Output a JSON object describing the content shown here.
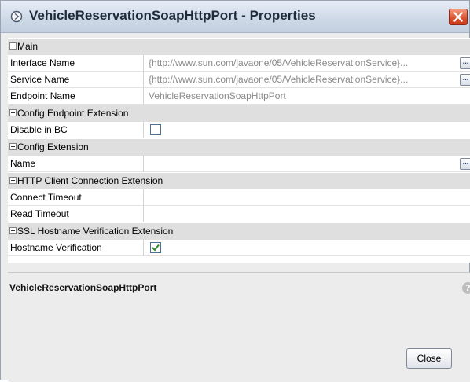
{
  "window": {
    "title": "VehicleReservationSoapHttpPort - Properties"
  },
  "sheet": {
    "main": {
      "category": "Main",
      "interface_name": {
        "label": "Interface Name",
        "value": "{http://www.sun.com/javaone/05/VehicleReservationService}..."
      },
      "service_name": {
        "label": "Service Name",
        "value": "{http://www.sun.com/javaone/05/VehicleReservationService}..."
      },
      "endpoint_name": {
        "label": "Endpoint Name",
        "value": "VehicleReservationSoapHttpPort"
      }
    },
    "config_endpoint": {
      "category": "Config Endpoint Extension",
      "disable_in_bc": {
        "label": "Disable in BC",
        "checked": false
      }
    },
    "config_extension": {
      "category": "Config Extension",
      "name": {
        "label": "Name",
        "value": ""
      }
    },
    "http_client": {
      "category": "HTTP Client Connection Extension",
      "connect_timeout": {
        "label": "Connect Timeout",
        "value": ""
      },
      "read_timeout": {
        "label": "Read Timeout",
        "value": ""
      }
    },
    "ssl": {
      "category": "SSL Hostname Verification Extension",
      "hostname_verification": {
        "label": "Hostname Verification",
        "checked": true
      }
    },
    "ellipsis_label": "..."
  },
  "description": {
    "title": "VehicleReservationSoapHttpPort",
    "help_glyph": "?"
  },
  "buttons": {
    "close": "Close"
  },
  "colors": {
    "accent": "#1f3a66",
    "close_red": "#d9502d",
    "category_bg": "#dfdfdf"
  }
}
